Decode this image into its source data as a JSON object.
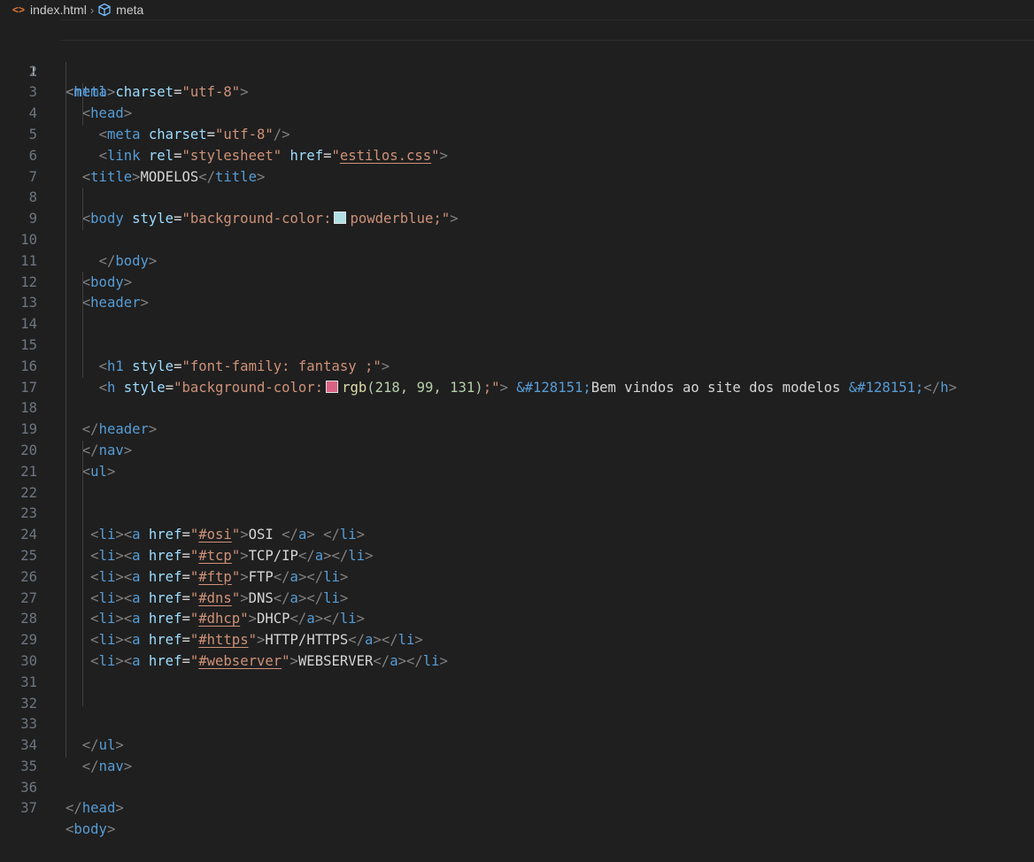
{
  "breadcrumb": {
    "file": "index.html",
    "symbol": "meta"
  },
  "colors": {
    "swatch_powderblue": "#b0e0e6",
    "swatch_rgb": "#da6383"
  },
  "editor": {
    "line_numbers": [
      "1",
      "2",
      "3",
      "4",
      "5",
      "6",
      "7",
      "8",
      "9",
      "10",
      "11",
      "12",
      "13",
      "14",
      "15",
      "16",
      "17",
      "18",
      "19",
      "20",
      "21",
      "22",
      "23",
      "24",
      "25",
      "26",
      "27",
      "28",
      "29",
      "30",
      "31",
      "32",
      "33",
      "34",
      "35",
      "36",
      "37"
    ],
    "code": {
      "meta_charset": "charset",
      "utf8": "\"utf-8\"",
      "head": "head",
      "link": "link",
      "rel": "rel",
      "stylesheet": "\"stylesheet\"",
      "href": "href",
      "estilos": "estilos.css",
      "title": "title",
      "modelos": "MODELOS",
      "body": "body",
      "style": "style",
      "bg_prefix": "\"background-color:",
      "powderblue": "powderblue;\"",
      "header": "header",
      "h1": "h1",
      "font_family": "\"font-family: fantasy ;\"",
      "h": "h",
      "rgb_fn": "rgb",
      "rgb_args": "(218, 99, 131)",
      "rgb_end": ";\"",
      "entity": "&#128151;",
      "welcome": "Bem vindos ao site dos modelos ",
      "nav": "nav",
      "ul": "ul",
      "li": "li",
      "a": "a",
      "items": [
        {
          "href": "#osi",
          "label": "OSI "
        },
        {
          "href": "#tcp",
          "label": "TCP/IP"
        },
        {
          "href": "#ftp",
          "label": "FTP"
        },
        {
          "href": "#dns",
          "label": "DNS"
        },
        {
          "href": "#dhcp",
          "label": "DHCP"
        },
        {
          "href": "#https",
          "label": "HTTP/HTTPS"
        },
        {
          "href": "#webserver",
          "label": "WEBSERVER"
        }
      ]
    }
  }
}
